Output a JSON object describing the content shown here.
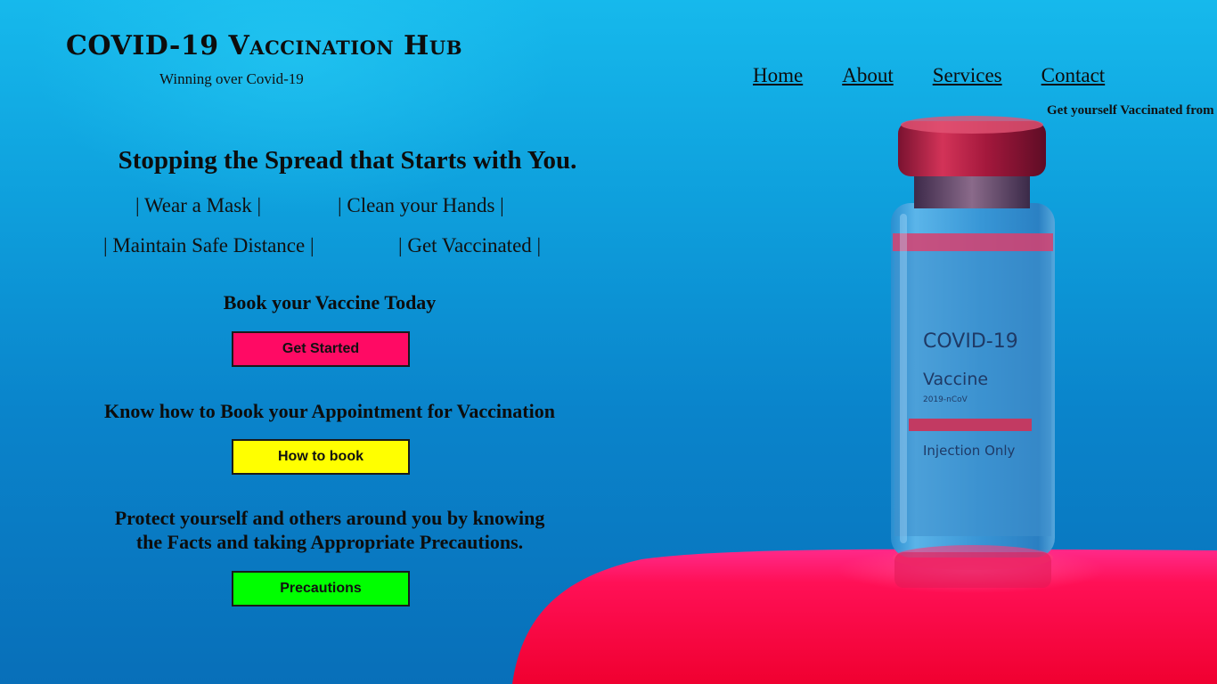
{
  "header": {
    "title": "COVID-19 Vaccination Hub",
    "tagline": "Winning over Covid-19"
  },
  "nav": {
    "items": [
      "Home",
      "About",
      "Services",
      "Contact"
    ]
  },
  "ticker": {
    "text": "Get yourself Vaccinated from"
  },
  "hero": {
    "headline": "Stopping the Spread that Starts with You.",
    "tips": [
      "| Wear a Mask |",
      "| Clean your Hands |",
      "| Maintain Safe Distance |",
      "| Get Vaccinated |"
    ]
  },
  "sections": {
    "book": {
      "title": "Book your Vaccine Today",
      "button_label": "Get Started",
      "button_color": "#ff0a64"
    },
    "howto": {
      "title": "Know how to Book your Appointment for Vaccination",
      "button_label": "How to book",
      "button_color": "#ffff00"
    },
    "precautions": {
      "title_line1": "Protect yourself and others around you by knowing",
      "title_line2": "the Facts and taking Appropriate Precautions.",
      "button_label": "Precautions",
      "button_color": "#00ff00"
    }
  },
  "vial": {
    "line1": "COVID-19",
    "line2": "Vaccine",
    "line3": "2019-nCoV",
    "line4": "Injection Only"
  },
  "theme": {
    "background": "#0e9fdc",
    "accent_pink": "#ff0a3c"
  }
}
